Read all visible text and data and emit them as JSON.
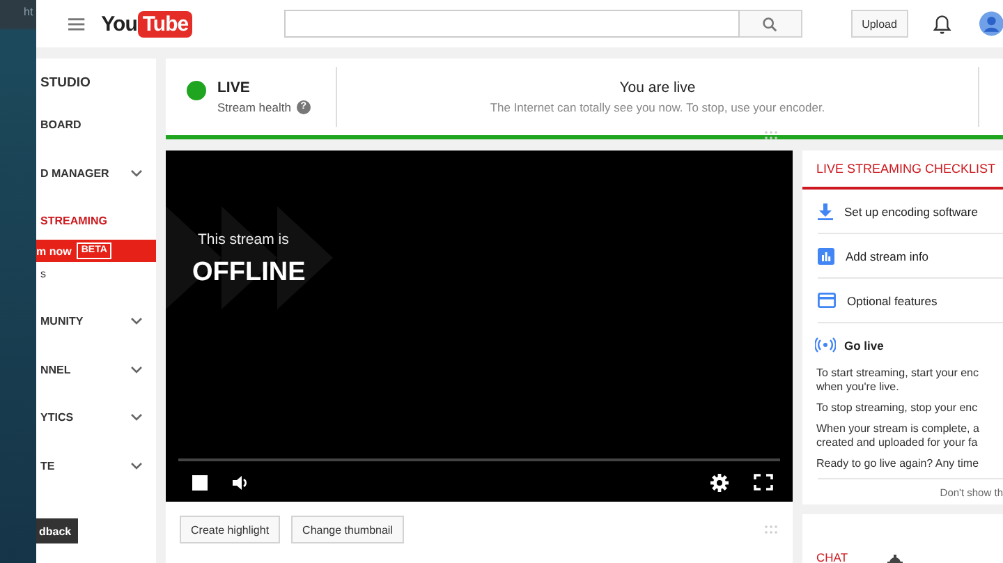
{
  "browser": {
    "address_fragment": "ht"
  },
  "header": {
    "logo": {
      "you": "You",
      "tube": "Tube"
    },
    "upload": "Upload"
  },
  "sidebar": {
    "items": [
      {
        "label": "STUDIO",
        "kind": "title",
        "chevron": false,
        "selected": false
      },
      {
        "label": "BOARD",
        "kind": "item",
        "chevron": false,
        "selected": false
      },
      {
        "label": "D MANAGER",
        "kind": "item",
        "chevron": true,
        "selected": false
      },
      {
        "label": "STREAMING",
        "kind": "item",
        "chevron": false,
        "selected": true
      },
      {
        "label": "m now",
        "kind": "live_now",
        "badge": "BETA",
        "chevron": false,
        "selected": true
      },
      {
        "label": "s",
        "kind": "sub",
        "chevron": false,
        "selected": false
      },
      {
        "label": "MUNITY",
        "kind": "item",
        "chevron": true,
        "selected": false
      },
      {
        "label": "NNEL",
        "kind": "item",
        "chevron": true,
        "selected": false
      },
      {
        "label": "YTICS",
        "kind": "item",
        "chevron": true,
        "selected": false
      },
      {
        "label": "TE",
        "kind": "item",
        "chevron": true,
        "selected": false
      }
    ],
    "feedback": "dback"
  },
  "status": {
    "title": "LIVE",
    "color": "#1fa51f",
    "subtitle": "Stream health",
    "help": "?"
  },
  "message": {
    "title": "You are live",
    "text": "The Internet can totally see you now. To stop, use your encoder."
  },
  "player": {
    "line1": "This stream is",
    "line2": "OFFLINE"
  },
  "actions": [
    "Create highlight",
    "Change thumbnail"
  ],
  "checklist": {
    "title": "LIVE STREAMING CHECKLIST",
    "steps": [
      {
        "label": "Set up encoding software",
        "kind": "download"
      },
      {
        "label": "Add stream info",
        "kind": "info"
      },
      {
        "label": "Optional features",
        "kind": "card"
      },
      {
        "label": "Go live",
        "kind": "live"
      }
    ],
    "paragraphs": [
      [
        "To start streaming, start your enc",
        "when you're live."
      ],
      [
        "To stop streaming, stop your enc"
      ],
      [
        "When your stream is complete, a",
        "created and uploaded for your fa"
      ],
      [
        "Ready to go live again? Any time"
      ]
    ],
    "footer": "Don't show th"
  },
  "chat": {
    "title": "CHAT"
  }
}
